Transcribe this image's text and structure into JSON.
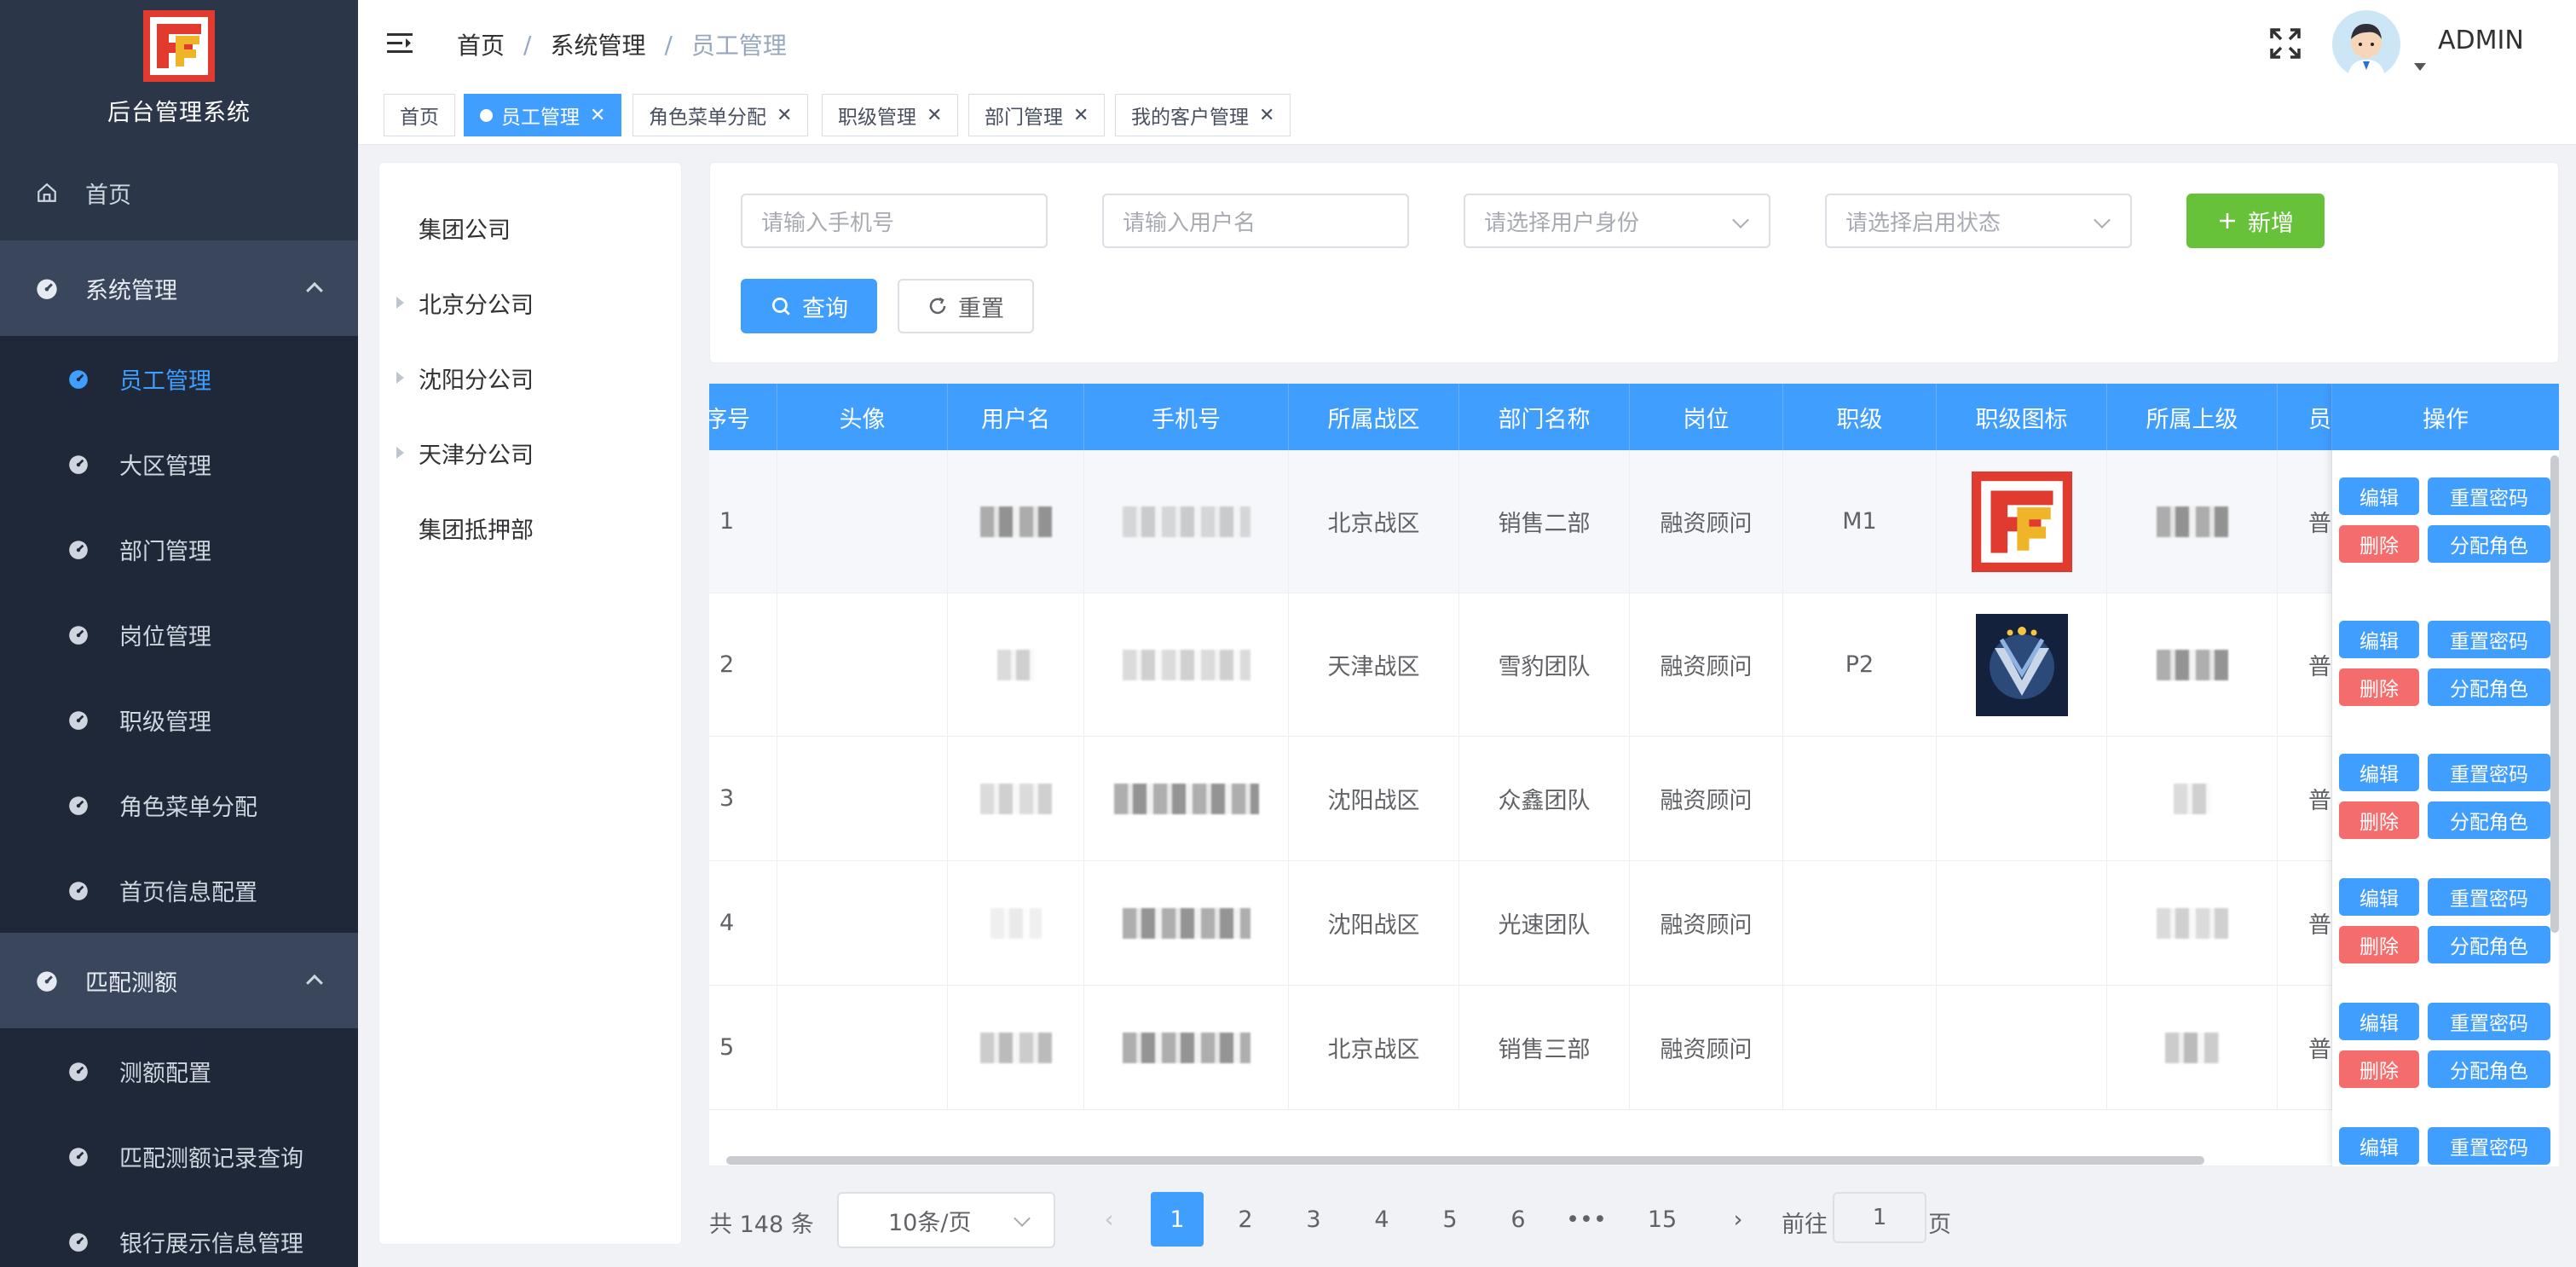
{
  "app": {
    "title": "后台管理系统"
  },
  "sidebar": {
    "home": "首页",
    "groups": [
      {
        "label": "系统管理",
        "items": [
          "员工管理",
          "大区管理",
          "部门管理",
          "岗位管理",
          "职级管理",
          "角色菜单分配",
          "首页信息配置"
        ]
      },
      {
        "label": "匹配测额",
        "items": [
          "测额配置",
          "匹配测额记录查询",
          "银行展示信息管理"
        ]
      }
    ],
    "active_item": "员工管理"
  },
  "header": {
    "breadcrumb": [
      "首页",
      "系统管理",
      "员工管理"
    ],
    "username": "ADMIN"
  },
  "tags": [
    {
      "label": "首页",
      "active": false,
      "closable": false
    },
    {
      "label": "员工管理",
      "active": true,
      "closable": true
    },
    {
      "label": "角色菜单分配",
      "active": false,
      "closable": true
    },
    {
      "label": "职级管理",
      "active": false,
      "closable": true
    },
    {
      "label": "部门管理",
      "active": false,
      "closable": true
    },
    {
      "label": "我的客户管理",
      "active": false,
      "closable": true
    }
  ],
  "tree": [
    {
      "label": "集团公司",
      "expandable": false
    },
    {
      "label": "北京分公司",
      "expandable": true
    },
    {
      "label": "沈阳分公司",
      "expandable": true
    },
    {
      "label": "天津分公司",
      "expandable": true
    },
    {
      "label": "集团抵押部",
      "expandable": false
    }
  ],
  "search": {
    "phone_placeholder": "请输入手机号",
    "username_placeholder": "请输入用户名",
    "identity_placeholder": "请选择用户身份",
    "status_placeholder": "请选择启用状态",
    "add_label": "新增",
    "query_label": "查询",
    "reset_label": "重置"
  },
  "table": {
    "columns": [
      "序号",
      "头像",
      "用户名",
      "手机号",
      "所属战区",
      "部门名称",
      "岗位",
      "职级",
      "职级图标",
      "所属上级",
      "员"
    ],
    "ops_header": "操作",
    "rows": [
      {
        "index": "1",
        "zone": "北京战区",
        "dept": "销售二部",
        "post": "融资顾问",
        "rank": "M1",
        "icon": "logo",
        "extra": "普"
      },
      {
        "index": "2",
        "zone": "天津战区",
        "dept": "雪豹团队",
        "post": "融资顾问",
        "rank": "P2",
        "icon": "badge",
        "extra": "普"
      },
      {
        "index": "3",
        "zone": "沈阳战区",
        "dept": "众鑫团队",
        "post": "融资顾问",
        "rank": "",
        "icon": "",
        "extra": "普"
      },
      {
        "index": "4",
        "zone": "沈阳战区",
        "dept": "光速团队",
        "post": "融资顾问",
        "rank": "",
        "icon": "",
        "extra": "普"
      },
      {
        "index": "5",
        "zone": "北京战区",
        "dept": "销售三部",
        "post": "融资顾问",
        "rank": "",
        "icon": "",
        "extra": "普"
      }
    ],
    "ops": {
      "edit": "编辑",
      "reset_pwd": "重置密码",
      "delete": "删除",
      "assign_role": "分配角色"
    }
  },
  "pagination": {
    "total": "共 148 条",
    "page_size": "10条/页",
    "pages": [
      "1",
      "2",
      "3",
      "4",
      "5",
      "6",
      "•••",
      "15"
    ],
    "current": "1",
    "goto_prefix": "前往",
    "goto_value": "1",
    "goto_suffix": "页"
  },
  "colors": {
    "primary": "#409eff",
    "success": "#67c23a",
    "danger": "#f56c6c",
    "sidebar": "#2b3649"
  }
}
